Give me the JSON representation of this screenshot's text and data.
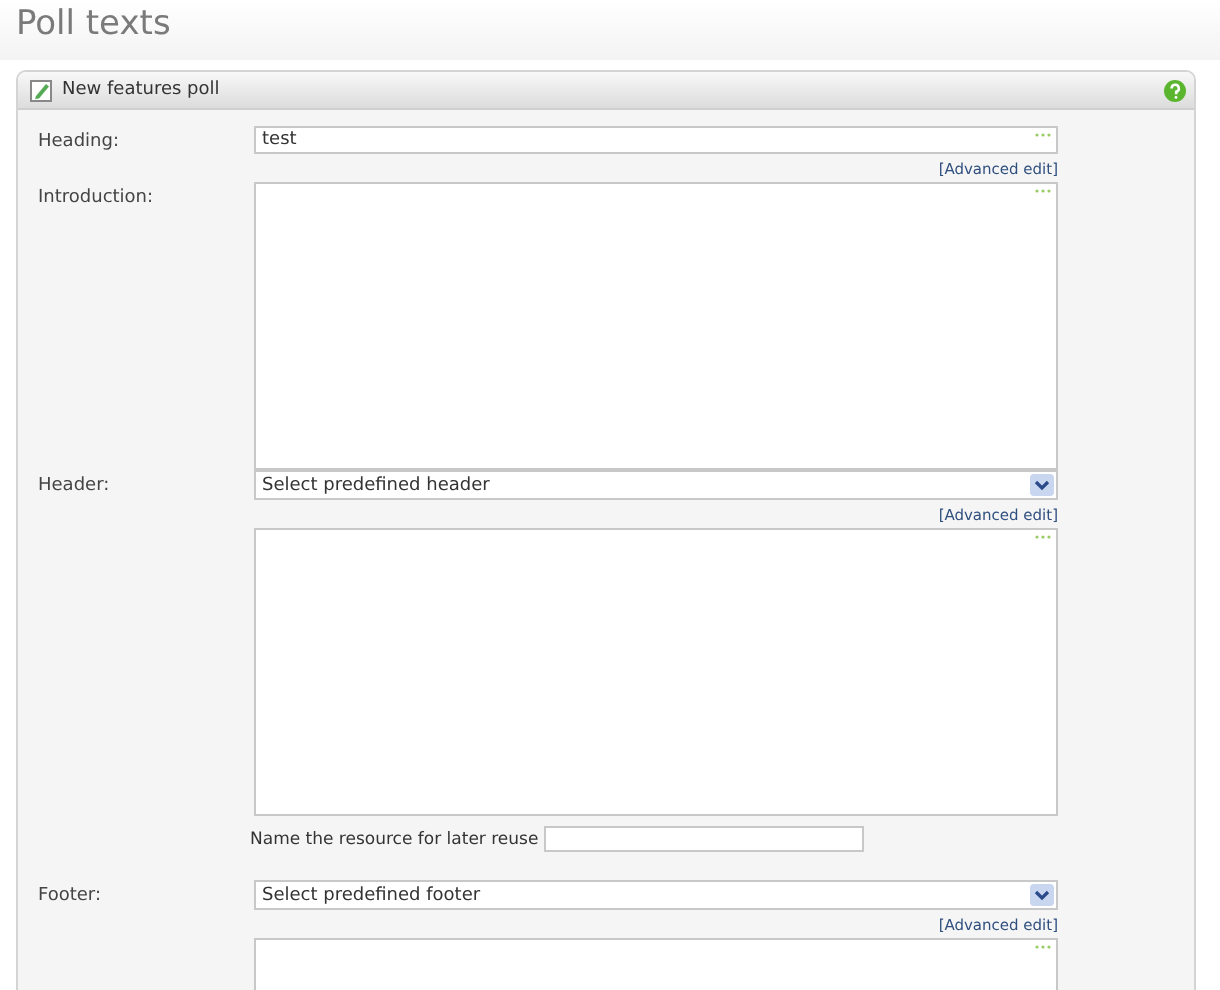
{
  "page_title": "Poll texts",
  "panel": {
    "title": "New features poll"
  },
  "fields": [
    {
      "kind": "input",
      "label": "Heading:",
      "value": "test",
      "advanced_link": "[Advanced edit]"
    },
    {
      "kind": "textarea",
      "label": "Introduction:"
    },
    {
      "kind": "select",
      "label": "Header:",
      "select": "Select predefined header",
      "advanced_link": "[Advanced edit]",
      "resource_label": "Name the resource for later reuse"
    },
    {
      "kind": "select",
      "label": "Footer:",
      "select": "Select predefined footer",
      "advanced_link": "[Advanced edit]"
    }
  ]
}
